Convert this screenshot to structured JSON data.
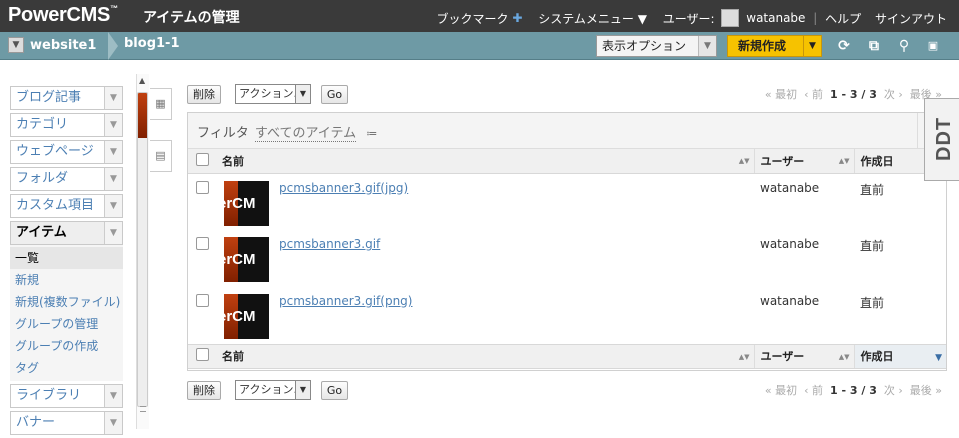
{
  "header": {
    "logo": "PowerCMS",
    "logo_tm": "™",
    "page_title": "アイテムの管理",
    "bookmark": "ブックマーク",
    "system_menu": "システムメニュー ▼",
    "user_label": "ユーザー:",
    "user_name": "watanabe",
    "help": "ヘルプ",
    "signout": "サインアウト"
  },
  "breadcrumb": {
    "website": "website1",
    "blog": "blog1-1"
  },
  "toolbar": {
    "display_options": "表示オプション",
    "new_label": "新規作成"
  },
  "sidebar": {
    "items": [
      {
        "label": "ブログ記事"
      },
      {
        "label": "カテゴリ"
      },
      {
        "label": "ウェブページ"
      },
      {
        "label": "フォルダ"
      },
      {
        "label": "カスタム項目"
      },
      {
        "label": "アイテム"
      }
    ],
    "subitems": [
      {
        "label": "一覧"
      },
      {
        "label": "新規"
      },
      {
        "label": "新規(複数ファイル)"
      },
      {
        "label": "グループの管理"
      },
      {
        "label": "グループの作成"
      },
      {
        "label": "タグ"
      }
    ],
    "more_items": [
      {
        "label": "ライブラリ"
      },
      {
        "label": "バナー"
      }
    ]
  },
  "actions": {
    "delete": "削除",
    "action_select": "アクション...",
    "go": "Go"
  },
  "pager": {
    "first": "« 最初",
    "prev": "‹ 前",
    "range": "1 - 3 / 3",
    "next": "次 ›",
    "last": "最後 »"
  },
  "filter": {
    "label": "フィルタ",
    "value": "すべてのアイテム",
    "menu_icon": "≔"
  },
  "table": {
    "columns": {
      "name": "名前",
      "user": "ユーザー",
      "created": "作成日"
    },
    "rows": [
      {
        "thumb_text": "erCM",
        "name": "pcmsbanner3.gif(jpg)",
        "user": "watanabe",
        "created": "直前"
      },
      {
        "thumb_text": "erCM",
        "name": "pcmsbanner3.gif",
        "user": "watanabe",
        "created": "直前"
      },
      {
        "thumb_text": "erCM",
        "name": "pcmsbanner3.gif(png)",
        "user": "watanabe",
        "created": "直前"
      }
    ]
  },
  "debug_tab": "DDT",
  "colors": {
    "topbar": "#3a3a3a",
    "breadcrumb": "#6e9aa5",
    "new_button": "#f6c200",
    "link": "#4c7fb3"
  }
}
